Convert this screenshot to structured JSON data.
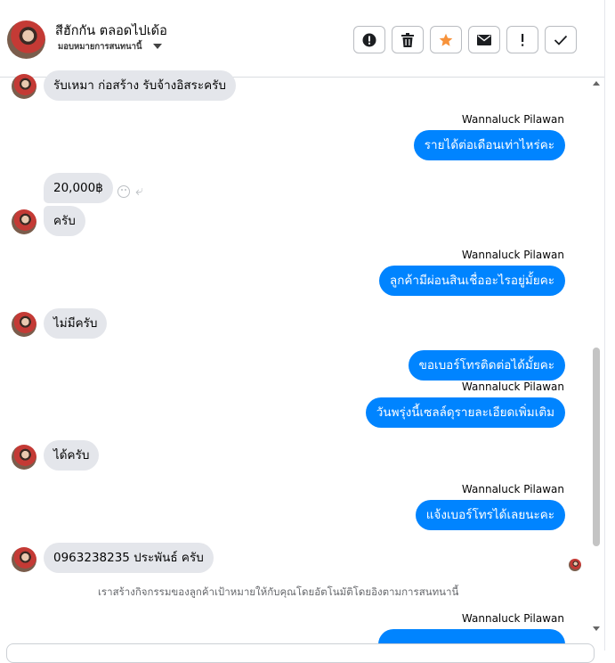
{
  "contact": {
    "name": "สีฮักกัน ตลอดไปเด้อ",
    "status": "มอบหมายการสนทนานี้"
  },
  "toolbar": {
    "icons": [
      "alert-circle-icon",
      "trash-icon",
      "star-icon",
      "mail-icon",
      "exclamation-icon",
      "check-icon"
    ],
    "accent_star": "#f7923a"
  },
  "messages": {
    "m1": "รับเหมา ก่อสร้าง รับจ้างอิสระครับ",
    "m2_sender": "Wannaluck Pilawan",
    "m2": "รายได้ต่อเดือนเท่าไหร่คะ",
    "m3": "20,000฿",
    "m4": "ครับ",
    "m5_sender": "Wannaluck Pilawan",
    "m5": "ลูกค้ามีผ่อนสินเชื่ออะไรอยู่มั้ยคะ",
    "m6": "ไม่มีครับ",
    "m7": "ขอเบอร์โทรติดต่อได้มั้ยคะ",
    "m8_sender": "Wannaluck Pilawan",
    "m8": "วันพรุ่งนี้เซลล์ดุรายละเอียดเพิ่มเติม",
    "m9": "ได้ครับ",
    "m10_sender": "Wannaluck Pilawan",
    "m10": "แจ้งเบอร์โทรได้เลยนะคะ",
    "m11": "0963238235 ประพันธ์ ครับ",
    "m12_sender": "Wannaluck Pilawan"
  },
  "system_note": "เราสร้างกิจกรรมของลูกค้าเป้าหมายให้กับคุณโดยอัตโนมัติโดยอิงตามการสนทนานี้",
  "colors": {
    "outgoing_bubble": "#0084ff",
    "incoming_bubble": "#e4e6eb"
  }
}
